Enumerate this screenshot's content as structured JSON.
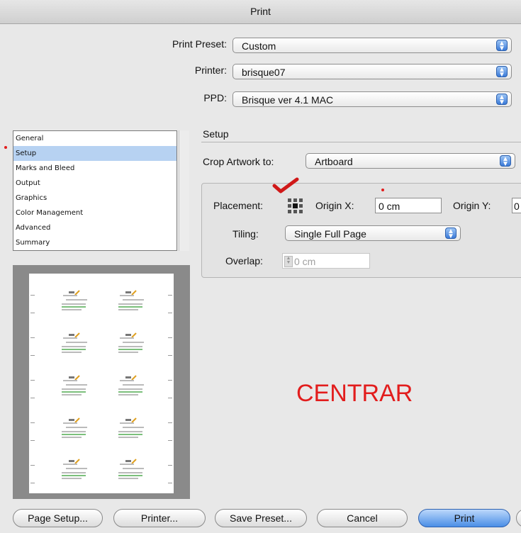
{
  "window": {
    "title": "Print"
  },
  "top": {
    "preset_label": "Print Preset:",
    "preset_value": "Custom",
    "printer_label": "Printer:",
    "printer_value": "brisque07",
    "ppd_label": "PPD:",
    "ppd_value": "Brisque ver 4.1 MAC"
  },
  "sidebar": {
    "items": [
      {
        "label": "General"
      },
      {
        "label": "Setup"
      },
      {
        "label": "Marks and Bleed"
      },
      {
        "label": "Output"
      },
      {
        "label": "Graphics"
      },
      {
        "label": "Color Management"
      },
      {
        "label": "Advanced"
      },
      {
        "label": "Summary"
      }
    ],
    "selected": "Setup"
  },
  "setup": {
    "heading": "Setup",
    "crop_label": "Crop Artwork to:",
    "crop_value": "Artboard",
    "placement_label": "Placement:",
    "origin_x_label": "Origin X:",
    "origin_x_value": "0 cm",
    "origin_y_label": "Origin Y:",
    "origin_y_value": "0",
    "tiling_label": "Tiling:",
    "tiling_value": "Single Full Page",
    "overlap_label": "Overlap:",
    "overlap_value": "0 cm"
  },
  "annotation": {
    "text": "CENTRAR",
    "color": "#e21d1d"
  },
  "buttons": {
    "page_setup": "Page Setup...",
    "printer": "Printer...",
    "save_preset": "Save Preset...",
    "cancel": "Cancel",
    "print": "Print"
  },
  "icons": {
    "popup_arrows": "updown-arrows-icon",
    "placement_grid": "placement-grid-icon",
    "checkmark": "red-check-icon"
  }
}
